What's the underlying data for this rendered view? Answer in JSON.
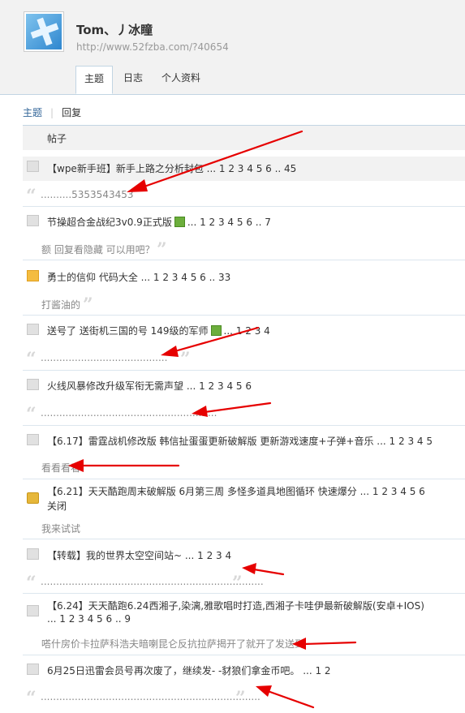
{
  "profile": {
    "name": "Tom、丿冰瞳",
    "url": "http://www.52fzba.com/?40654"
  },
  "tabs": [
    {
      "label": "主题"
    },
    {
      "label": "日志"
    },
    {
      "label": "个人资料"
    }
  ],
  "subnav": {
    "topics": "主题",
    "replies": "回复"
  },
  "table_header": "帖子",
  "posts": [
    {
      "icon": "post-icon",
      "title": "【wpe新手班】新手上路之分析封包 ...",
      "pages": "1  2  3  4  5  6 .. 45",
      "quote": "..........5353543453"
    },
    {
      "icon": "post-icon",
      "title": "节操超合金战纪3v0.9正式版",
      "pages": "...  1  2  3  4  5  6 .. 7",
      "quote": "额 回复看隐藏 可以用吧？"
    },
    {
      "icon": "folder-icon",
      "title": "勇士的信仰 代码大全 ...",
      "pages": "1  2  3  4  5  6 .. 33",
      "quote": "打酱油的"
    },
    {
      "icon": "post-icon",
      "title": "送号了 送街机三国的号 149级的军师",
      "pages": "...  1  2  3  4",
      "quote": "........................................."
    },
    {
      "icon": "post-icon",
      "title": "火线风暴修改升级军衔无需声望 ...",
      "pages": "1  2  3  4  5  6",
      "quote": "........................................................."
    },
    {
      "icon": "post-icon",
      "title": "【6.17】雷霆战机修改版 韩信扯蛋蛋更新破解版 更新游戏速度+子弹+音乐 ...",
      "pages": "1  2  3  4  5",
      "quote": "看看看看"
    },
    {
      "icon": "lock-icon",
      "title": "【6.21】天天酷跑周末破解版 6月第三周 多怪多道具地图循环 快速爆分 ...",
      "pages": "1  2  3  4  5  6",
      "title2": "关闭",
      "quote": "我来试试"
    },
    {
      "icon": "post-icon",
      "title": "【转载】我的世界太空空间站~ ...",
      "pages": "1  2  3  4",
      "quote": "........................................................................"
    },
    {
      "icon": "post-icon",
      "title": "【6.24】天天酷跑6.24西湘子,染漓,雅歌唱时打造,西湘子卡哇伊最新破解版(安卓+IOS)",
      "title2": "...  1  2  3  4  5  6 .. 9",
      "quote": "嗒什房价卡拉萨科浩夫暗喇昆仑反抗拉萨揭开了就开了发送到"
    },
    {
      "icon": "post-icon",
      "title": "6月25日迅雷会员号再次废了，继续发- -豺狼们拿金币吧。 ...",
      "pages": "1  2",
      "quote": "......................................................................."
    }
  ],
  "colors": {
    "link": "#336699",
    "annotation_arrow": "#e60000",
    "border": "#c2d5e3"
  }
}
